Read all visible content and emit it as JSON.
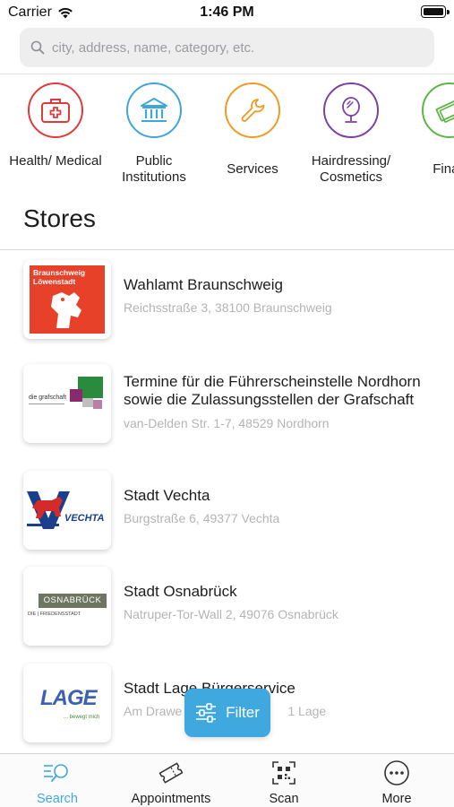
{
  "status_bar": {
    "carrier": "Carrier",
    "time": "1:46 PM"
  },
  "search": {
    "placeholder": "city, address, name, category, etc."
  },
  "categories": [
    {
      "label": "Health/ Medical",
      "icon": "first-aid-kit-icon",
      "color": "#e03a3a"
    },
    {
      "label": "Public Institutions",
      "icon": "public-building-icon",
      "color": "#3fa6dd"
    },
    {
      "label": "Services",
      "icon": "wrench-icon",
      "color": "#ef9a22"
    },
    {
      "label": "Hairdressing/ Cosmetics",
      "icon": "mirror-icon",
      "color": "#7d3fa8"
    },
    {
      "label": "Finan",
      "icon": "money-icon",
      "color": "#5db545"
    }
  ],
  "section_title": "Stores",
  "stores": [
    {
      "name": "Wahlamt Braunschweig",
      "address": "Reichsstraße 3, 38100 Braunschweig",
      "logo_text": "Braunschweig Löwenstadt"
    },
    {
      "name": "Termine für die Führerscheinstelle Nordhorn sowie die Zulassungsstellen der Grafschaft",
      "address": "van-Delden Str.  1-7, 48529 Nordhorn",
      "logo_text": "die grafschaft"
    },
    {
      "name": "Stadt Vechta",
      "address": "Burgstraße 6, 49377 Vechta",
      "logo_text": "VECHTA"
    },
    {
      "name": "Stadt Osnabrück",
      "address": "Natruper-Tor-Wall 2, 49076 Osnabrück",
      "logo_text": "OSNABRÜCK",
      "logo_subtext": "DIE | FRIEDENSSTADT"
    },
    {
      "name": "Stadt Lage Bürgerservice",
      "address": "Am Drawe",
      "address_tail": "1 Lage",
      "logo_text": "LAGE",
      "logo_subtext": "... bewegt mich"
    }
  ],
  "filter_button": {
    "label": "Filter"
  },
  "tabs": [
    {
      "label": "Search",
      "icon": "search-list-icon",
      "active": true
    },
    {
      "label": "Appointments",
      "icon": "ticket-icon",
      "active": false
    },
    {
      "label": "Scan",
      "icon": "qr-scan-icon",
      "active": false
    },
    {
      "label": "More",
      "icon": "more-dots-icon",
      "active": false
    }
  ],
  "colors": {
    "accent": "#3ea8df",
    "secondary_text": "#b4b4b4"
  }
}
